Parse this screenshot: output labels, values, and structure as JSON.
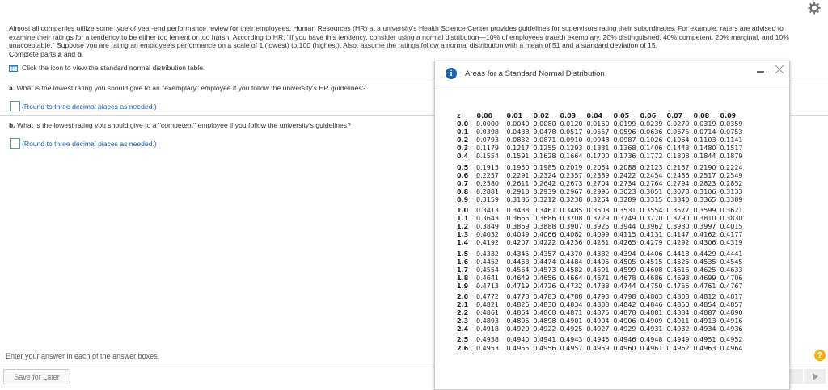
{
  "intro": "Almost all companies utilize some type of year-end performance review for their employees. Human Resources (HR) at a university's Health Science Center provides guidelines for supervisors rating their subordinates. For example, raters are advised to examine their ratings for a tendency to be either too lenient or too harsh. According to HR, \"If you have this tendency, consider using a normal distribution—10% of employees (rated) exemplary, 20% distinguished, 40% competent, 20% marginal, and 10% unacceptable.\" Suppose you are rating an employee's performance on a scale of 1 (lowest) to 100 (highest). Also, assume the ratings follow a normal distribution with a mean of 51 and a standard deviation of 15.",
  "complete_prefix": "Complete parts ",
  "part_a_letter": "a",
  "and_word": " and ",
  "part_b_letter": "b",
  "period": ".",
  "icon_hint": "Click the icon to view the standard normal distribution table.",
  "question_a": {
    "label": "a.",
    "text": " What is the lowest rating you should give to an \"exemplary\" employee if you follow the university's HR guidelines?",
    "note": "(Round to three decimal places as needed.)"
  },
  "question_b": {
    "label": "b.",
    "text": " What is the lowest rating you should give to a \"competent\" employee if you follow the university's guidelines?",
    "note": "(Round to three decimal places as needed.)"
  },
  "footer": {
    "instructions": "Enter your answer in each of the answer boxes.",
    "save_label": "Save for Later",
    "help_label": "?"
  },
  "popup": {
    "title": "Areas for a Standard Normal Distribution",
    "info_label": "i",
    "headers": [
      "z",
      "0.00",
      "0.01",
      "0.02",
      "0.03",
      "0.04",
      "0.05",
      "0.06",
      "0.07",
      "0.08",
      "0.09"
    ],
    "rows": [
      [
        "0.0",
        "0.0000",
        "0.0040",
        "0.0080",
        "0.0120",
        "0.0160",
        "0.0199",
        "0.0239",
        "0.0279",
        "0.0319",
        "0.0359"
      ],
      [
        "0.1",
        "0.0398",
        "0.0438",
        "0.0478",
        "0.0517",
        "0.0557",
        "0.0596",
        "0.0636",
        "0.0675",
        "0.0714",
        "0.0753"
      ],
      [
        "0.2",
        "0.0793",
        "0.0832",
        "0.0871",
        "0.0910",
        "0.0948",
        "0.0987",
        "0.1026",
        "0.1064",
        "0.1103",
        "0.1141"
      ],
      [
        "0.3",
        "0.1179",
        "0.1217",
        "0.1255",
        "0.1293",
        "0.1331",
        "0.1368",
        "0.1406",
        "0.1443",
        "0.1480",
        "0.1517"
      ],
      [
        "0.4",
        "0.1554",
        "0.1591",
        "0.1628",
        "0.1664",
        "0.1700",
        "0.1736",
        "0.1772",
        "0.1808",
        "0.1844",
        "0.1879"
      ],
      [
        "0.5",
        "0.1915",
        "0.1950",
        "0.1985",
        "0.2019",
        "0.2054",
        "0.2088",
        "0.2123",
        "0.2157",
        "0.2190",
        "0.2224"
      ],
      [
        "0.6",
        "0.2257",
        "0.2291",
        "0.2324",
        "0.2357",
        "0.2389",
        "0.2422",
        "0.2454",
        "0.2486",
        "0.2517",
        "0.2549"
      ],
      [
        "0.7",
        "0.2580",
        "0.2611",
        "0.2642",
        "0.2673",
        "0.2704",
        "0.2734",
        "0.2764",
        "0.2794",
        "0.2823",
        "0.2852"
      ],
      [
        "0.8",
        "0.2881",
        "0.2910",
        "0.2939",
        "0.2967",
        "0.2995",
        "0.3023",
        "0.3051",
        "0.3078",
        "0.3106",
        "0.3133"
      ],
      [
        "0.9",
        "0.3159",
        "0.3186",
        "0.3212",
        "0.3238",
        "0.3264",
        "0.3289",
        "0.3315",
        "0.3340",
        "0.3365",
        "0.3389"
      ],
      [
        "1.0",
        "0.3413",
        "0.3438",
        "0.3461",
        "0.3485",
        "0.3508",
        "0.3531",
        "0.3554",
        "0.3577",
        "0.3599",
        "0.3621"
      ],
      [
        "1.1",
        "0.3643",
        "0.3665",
        "0.3686",
        "0.3708",
        "0.3729",
        "0.3749",
        "0.3770",
        "0.3790",
        "0.3810",
        "0.3830"
      ],
      [
        "1.2",
        "0.3849",
        "0.3869",
        "0.3888",
        "0.3907",
        "0.3925",
        "0.3944",
        "0.3962",
        "0.3980",
        "0.3997",
        "0.4015"
      ],
      [
        "1.3",
        "0.4032",
        "0.4049",
        "0.4066",
        "0.4082",
        "0.4099",
        "0.4115",
        "0.4131",
        "0.4147",
        "0.4162",
        "0.4177"
      ],
      [
        "1.4",
        "0.4192",
        "0.4207",
        "0.4222",
        "0.4236",
        "0.4251",
        "0.4265",
        "0.4279",
        "0.4292",
        "0.4306",
        "0.4319"
      ],
      [
        "1.5",
        "0.4332",
        "0.4345",
        "0.4357",
        "0.4370",
        "0.4382",
        "0.4394",
        "0.4406",
        "0.4418",
        "0.4429",
        "0.4441"
      ],
      [
        "1.6",
        "0.4452",
        "0.4463",
        "0.4474",
        "0.4484",
        "0.4495",
        "0.4505",
        "0.4515",
        "0.4525",
        "0.4535",
        "0.4545"
      ],
      [
        "1.7",
        "0.4554",
        "0.4564",
        "0.4573",
        "0.4582",
        "0.4591",
        "0.4599",
        "0.4608",
        "0.4616",
        "0.4625",
        "0.4633"
      ],
      [
        "1.8",
        "0.4641",
        "0.4649",
        "0.4656",
        "0.4664",
        "0.4671",
        "0.4678",
        "0.4686",
        "0.4693",
        "0.4699",
        "0.4706"
      ],
      [
        "1.9",
        "0.4713",
        "0.4719",
        "0.4726",
        "0.4732",
        "0.4738",
        "0.4744",
        "0.4750",
        "0.4756",
        "0.4761",
        "0.4767"
      ],
      [
        "2.0",
        "0.4772",
        "0.4778",
        "0.4783",
        "0.4788",
        "0.4793",
        "0.4798",
        "0.4803",
        "0.4808",
        "0.4812",
        "0.4817"
      ],
      [
        "2.1",
        "0.4821",
        "0.4826",
        "0.4830",
        "0.4834",
        "0.4838",
        "0.4842",
        "0.4846",
        "0.4850",
        "0.4854",
        "0.4857"
      ],
      [
        "2.2",
        "0.4861",
        "0.4864",
        "0.4868",
        "0.4871",
        "0.4875",
        "0.4878",
        "0.4881",
        "0.4884",
        "0.4887",
        "0.4890"
      ],
      [
        "2.3",
        "0.4893",
        "0.4896",
        "0.4898",
        "0.4901",
        "0.4904",
        "0.4906",
        "0.4909",
        "0.4911",
        "0.4913",
        "0.4916"
      ],
      [
        "2.4",
        "0.4918",
        "0.4920",
        "0.4922",
        "0.4925",
        "0.4927",
        "0.4929",
        "0.4931",
        "0.4932",
        "0.4934",
        "0.4936"
      ],
      [
        "2.5",
        "0.4938",
        "0.4940",
        "0.4941",
        "0.4943",
        "0.4945",
        "0.4946",
        "0.4948",
        "0.4949",
        "0.4951",
        "0.4952"
      ],
      [
        "2.6",
        "0.4953",
        "0.4955",
        "0.4956",
        "0.4957",
        "0.4959",
        "0.4960",
        "0.4961",
        "0.4962",
        "0.4963",
        "0.4964"
      ]
    ]
  },
  "colors": {
    "link_blue": "#1a5ca8",
    "info_blue": "#1b61b3",
    "help_yellow": "#f0b41a"
  },
  "icons": [
    "gear-icon",
    "table-icon",
    "info-icon",
    "minimize-icon",
    "close-icon",
    "help-icon",
    "next-arrow-icon"
  ]
}
